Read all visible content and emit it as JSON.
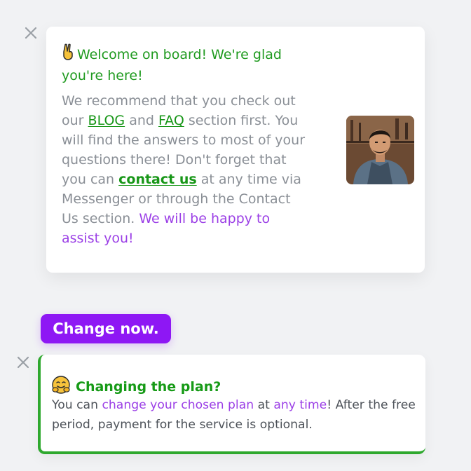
{
  "welcome_card": {
    "title": "Welcome on board! We're glad you're here!",
    "body": {
      "p1": "We recommend that you check out our ",
      "blog_link": "BLOG",
      "p2": " and ",
      "faq_link": "FAQ",
      "p3": " section first. You will find the answers to most of your questions there! Don't forget that you can ",
      "contact_link": "contact us",
      "p4": " at any time via Messenger or through the Contact Us section. ",
      "highlight": "We will be happy to assist you!"
    }
  },
  "change_button": {
    "label": "Change now."
  },
  "plan_card": {
    "title": "Changing the plan?",
    "body": {
      "p1": "You can ",
      "plan_link": "change your chosen plan",
      "p2": " at ",
      "time_link": "any time",
      "p3": "! After the free period, payment for the service is optional."
    }
  },
  "icons": {
    "close": "close-icon",
    "victory_hand": "victory-hand-emoji",
    "hugging_face": "hugging-face-emoji"
  },
  "colors": {
    "green": "#1f9a1f",
    "purple": "#9b3fe6",
    "button_purple": "#8e17f4",
    "border_green": "#2ea82e",
    "muted_text": "#8a8f96"
  }
}
